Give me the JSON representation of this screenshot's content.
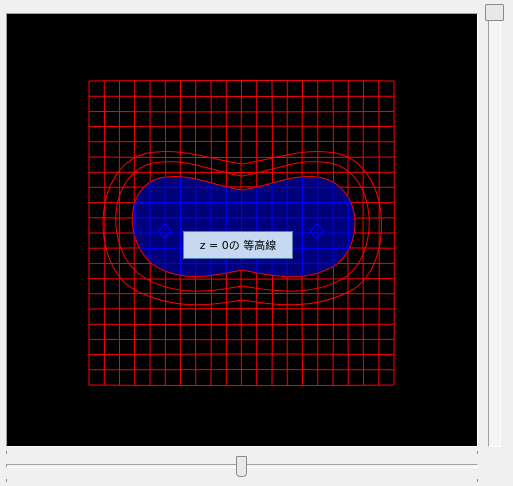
{
  "viewport": {
    "background": "#000000",
    "grid_color": "#ff0000",
    "inner_grid_color": "#0000ff",
    "fill_color": "#00007a"
  },
  "tooltip": {
    "text": "z = 0の 等高線"
  },
  "vertical_slider": {
    "value_fraction": 0.0
  },
  "horizontal_slider": {
    "value_fraction": 0.5
  }
}
